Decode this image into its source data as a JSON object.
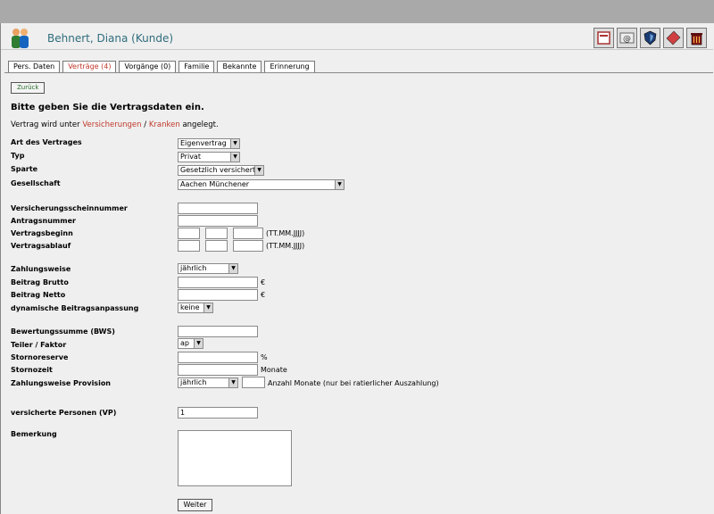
{
  "header": {
    "title": "Behnert, Diana (Kunde)"
  },
  "tabs": [
    {
      "label": "Pers. Daten",
      "active": false
    },
    {
      "label": "Verträge (4)",
      "active": true
    },
    {
      "label": "Vorgänge (0)",
      "active": false
    },
    {
      "label": "Familie",
      "active": false
    },
    {
      "label": "Bekannte",
      "active": false
    },
    {
      "label": "Erinnerung",
      "active": false
    }
  ],
  "toolbar": {
    "icons": [
      "document-icon",
      "email-icon",
      "shield-icon",
      "stamp-icon",
      "trash-icon"
    ]
  },
  "form": {
    "back_label": "Zurück",
    "heading": "Bitte geben Sie die Vertragsdaten ein.",
    "info_prefix": "Vertrag wird unter",
    "info_link1": "Versicherungen",
    "info_sep": "/",
    "info_link2": "Kranken",
    "info_suffix": "angelegt.",
    "art_label": "Art des Vertrages",
    "art_value": "Eigenvertrag",
    "typ_label": "Typ",
    "typ_value": "Privat",
    "sparte_label": "Sparte",
    "sparte_value": "Gesetzlich versichert",
    "gesellschaft_label": "Gesellschaft",
    "gesellschaft_value": "Aachen Münchener",
    "vsnr_label": "Versicherungsscheinnummer",
    "antrag_label": "Antragsnummer",
    "beginn_label": "Vertragsbeginn",
    "ablauf_label": "Vertragsablauf",
    "date_hint": "(TT.MM.JJJJ)",
    "zahlweise_label": "Zahlungsweise",
    "zahlweise_value": "jährlich",
    "brutto_label": "Beitrag Brutto",
    "netto_label": "Beitrag Netto",
    "currency": "€",
    "dynamik_label": "dynamische Beitragsanpassung",
    "dynamik_value": "keine",
    "bws_label": "Bewertungssumme (BWS)",
    "teiler_label": "Teiler / Faktor",
    "teiler_value": "ap",
    "stornoreserve_label": "Stornoreserve",
    "percent": "%",
    "stornozeit_label": "Stornozeit",
    "monate": "Monate",
    "zahlweise_prov_label": "Zahlungsweise Provision",
    "zahlweise_prov_value": "jährlich",
    "anzahl_hint": "Anzahl Monate (nur bei ratierlicher Auszahlung)",
    "vp_label": "versicherte Personen (VP)",
    "vp_value": "1",
    "bemerkung_label": "Bemerkung",
    "weiter_label": "Weiter"
  },
  "colors": {
    "title": "#2f6d7c",
    "link": "#c0392b",
    "back_text": "#276b2b"
  }
}
